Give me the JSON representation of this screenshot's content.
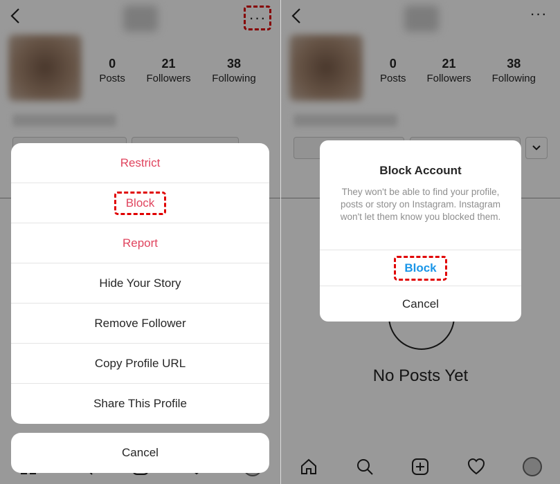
{
  "left": {
    "profile": {
      "stats": [
        {
          "value": "0",
          "label": "Posts"
        },
        {
          "value": "21",
          "label": "Followers"
        },
        {
          "value": "38",
          "label": "Following"
        }
      ]
    },
    "action_sheet": {
      "items": [
        {
          "label": "Restrict",
          "style": "destructive"
        },
        {
          "label": "Block",
          "style": "destructive",
          "highlighted": true
        },
        {
          "label": "Report",
          "style": "destructive"
        },
        {
          "label": "Hide Your Story",
          "style": "default"
        },
        {
          "label": "Remove Follower",
          "style": "default"
        },
        {
          "label": "Copy Profile URL",
          "style": "default"
        },
        {
          "label": "Share This Profile",
          "style": "default"
        }
      ],
      "cancel_label": "Cancel"
    }
  },
  "right": {
    "profile": {
      "stats": [
        {
          "value": "0",
          "label": "Posts"
        },
        {
          "value": "21",
          "label": "Followers"
        },
        {
          "value": "38",
          "label": "Following"
        }
      ],
      "empty_state": "No Posts Yet"
    },
    "dialog": {
      "title": "Block Account",
      "message": "They won't be able to find your profile, posts or story on Instagram. Instagram won't let them know you blocked them.",
      "confirm_label": "Block",
      "cancel_label": "Cancel"
    }
  },
  "colors": {
    "destructive": "#e0445e",
    "accent": "#1a96e8",
    "highlight_box": "#e00000",
    "overlay": "rgba(0,0,0,0.4)"
  },
  "icons": [
    "back-arrow-icon",
    "more-options-icon",
    "home-icon",
    "search-icon",
    "add-post-icon",
    "heart-icon",
    "profile-avatar-icon",
    "chevron-down-icon"
  ]
}
